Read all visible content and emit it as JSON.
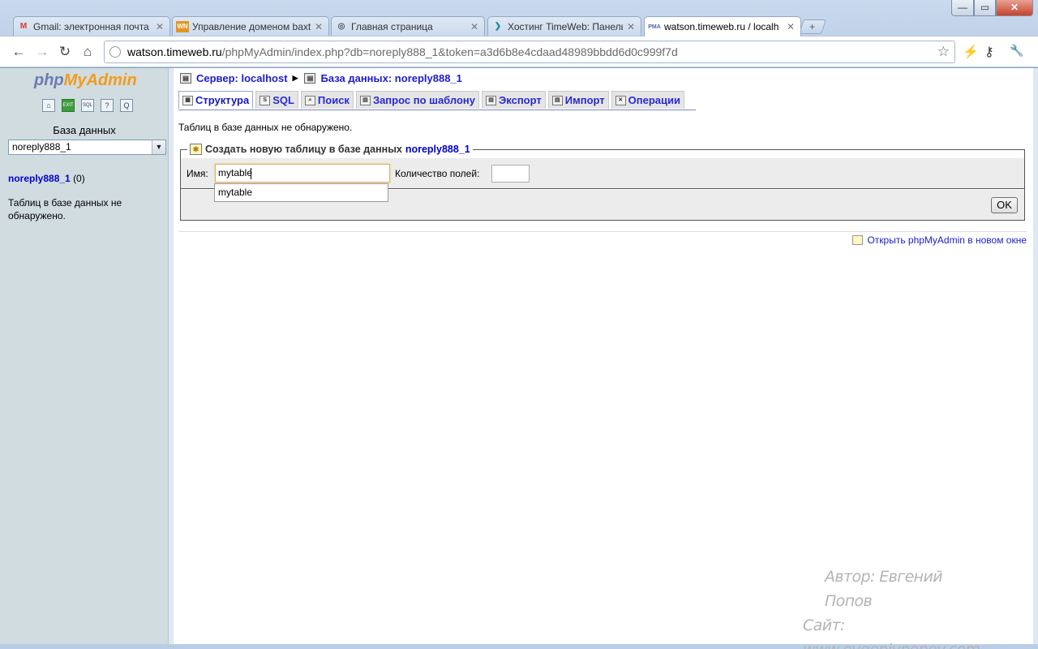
{
  "browser": {
    "tabs": [
      {
        "title": "Gmail: электронная почта",
        "favicon": "M",
        "favicon_color": "#d23b2c"
      },
      {
        "title": "Управление доменом baxt",
        "favicon": "WN",
        "favicon_color": "#e39522"
      },
      {
        "title": "Главная страница",
        "favicon": "◎",
        "favicon_color": "#555555"
      },
      {
        "title": "Хостинг TimeWeb: Панель",
        "favicon": "❯",
        "favicon_color": "#1a8aa0"
      },
      {
        "title": "watson.timeweb.ru / localh",
        "favicon": "PMA",
        "favicon_color": "#4a6ba8",
        "active": true
      }
    ],
    "new_tab": "+",
    "window_min": "—",
    "window_max": "▭",
    "window_close": "✕",
    "url_host": "watson.timeweb.ru",
    "url_rest": "/phpMyAdmin/index.php?db=noreply888_1&token=a3d6b8e4cdaad48989bbdd6d0c999f7d",
    "icons": {
      "back": "←",
      "forward": "→",
      "reload": "↻",
      "home": "⌂",
      "star": "☆",
      "lightning": "⚡",
      "key": "⚷",
      "wrench": "🔧"
    }
  },
  "left": {
    "logo_php": "php",
    "logo_my": "My",
    "logo_admin": "Admin",
    "icons": [
      "⌂",
      "EXIT",
      "SQL",
      "?",
      "Q"
    ],
    "db_label": "База данных",
    "db_selected": "noreply888_1",
    "db_name": "noreply888_1",
    "db_count": "(0)",
    "no_tables": "Таблиц в базе данных не обнаружено."
  },
  "main": {
    "breadcrumb_server": "Сервер: localhost",
    "breadcrumb_db": "База данных: noreply888_1",
    "tabs": [
      {
        "label": "Структура",
        "active": true
      },
      {
        "label": "SQL"
      },
      {
        "label": "Поиск"
      },
      {
        "label": "Запрос по шаблону"
      },
      {
        "label": "Экспорт"
      },
      {
        "label": "Импорт"
      },
      {
        "label": "Операции"
      }
    ],
    "no_tables": "Таблиц в базе данных не обнаружено.",
    "create_legend": "Создать новую таблицу в базе данных",
    "create_db": "noreply888_1",
    "name_label": "Имя:",
    "name_value": "mytable",
    "fields_label": "Количество полей:",
    "fields_value": "",
    "ok_label": "OK",
    "autocomplete_option": "mytable",
    "open_new_window": "Открыть phpMyAdmin в новом окне"
  },
  "watermark": {
    "line1": "Автор: Евгений Попов",
    "line2_prefix": "Сайт: ",
    "line2_url": "www.evgeniypopov.com"
  }
}
